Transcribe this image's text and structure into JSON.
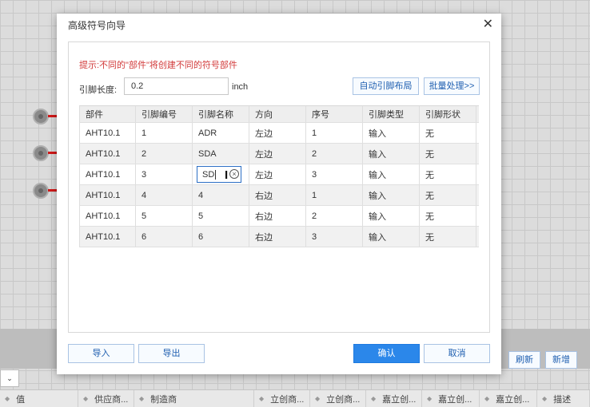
{
  "dialog": {
    "title": "高级符号向导",
    "close_icon": "close-icon",
    "hint": "提示:不同的\"部件\"将创建不同的符号部件",
    "pin_length_label": "引脚长度:",
    "pin_length_value": "0.2",
    "pin_length_unit": "inch",
    "auto_layout_label": "自动引脚布局",
    "batch_label": "批量处理>>",
    "columns": [
      "部件",
      "引脚编号",
      "引脚名称",
      "方向",
      "序号",
      "引脚类型",
      "引脚形状"
    ],
    "rows": [
      [
        "AHT10.1",
        "1",
        "ADR",
        "左边",
        "1",
        "输入",
        "无"
      ],
      [
        "AHT10.1",
        "2",
        "SDA",
        "左边",
        "2",
        "输入",
        "无"
      ],
      [
        "AHT10.1",
        "3",
        "SD",
        "左边",
        "3",
        "输入",
        "无"
      ],
      [
        "AHT10.1",
        "4",
        "4",
        "右边",
        "1",
        "输入",
        "无"
      ],
      [
        "AHT10.1",
        "5",
        "5",
        "右边",
        "2",
        "输入",
        "无"
      ],
      [
        "AHT10.1",
        "6",
        "6",
        "右边",
        "3",
        "输入",
        "无"
      ]
    ],
    "import_label": "导入",
    "export_label": "导出",
    "ok_label": "确认",
    "cancel_label": "取消"
  },
  "background": {
    "refresh_label": "刷新",
    "add_label": "新增",
    "dropdown_glyph": "⌄",
    "table_headers": [
      "值",
      "供应商...",
      "制造商",
      "立创商...",
      "立创商...",
      "嘉立创...",
      "嘉立创...",
      "嘉立创...",
      "描述"
    ]
  },
  "colors": {
    "accent": "#2b87ea",
    "hint": "#d23a3a",
    "pin": "#d21818"
  }
}
